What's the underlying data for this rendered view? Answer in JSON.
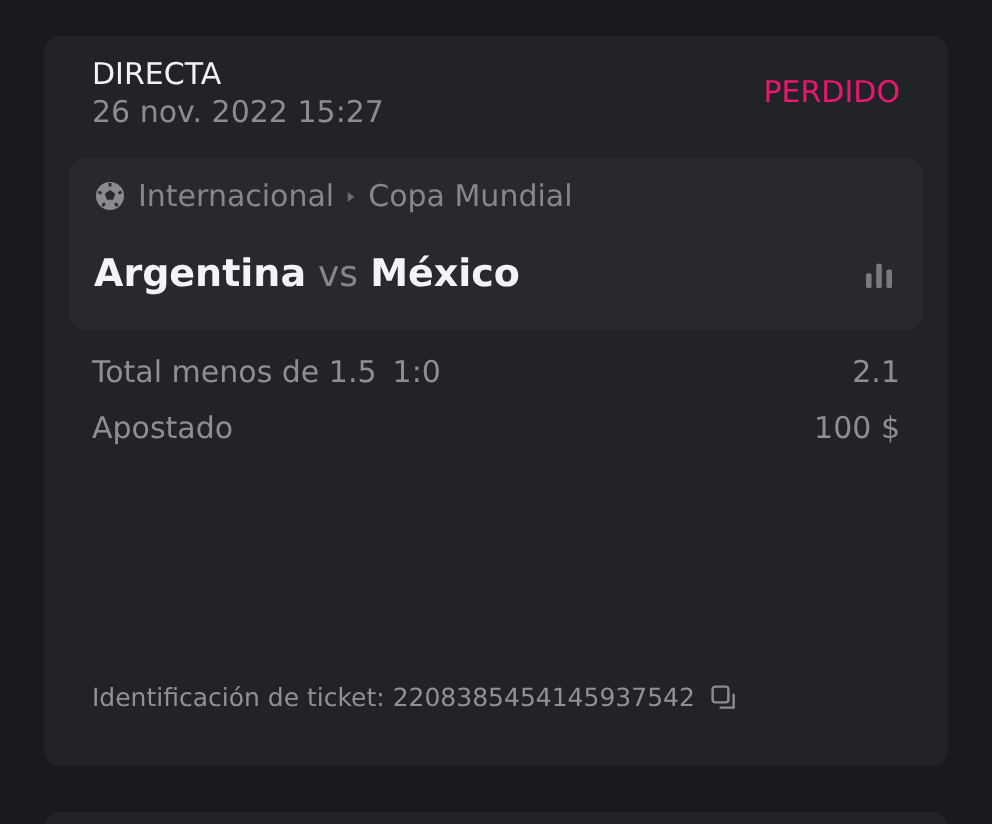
{
  "bet": {
    "type": "DIRECTA",
    "date": "26 nov. 2022 15:27",
    "lost": true,
    "result_label": "PERDIDO"
  },
  "event": {
    "category": "Internacional",
    "league": "Copa Mundial",
    "home": "Argentina",
    "vs": "vs",
    "away": "México"
  },
  "selection": {
    "market": "Total menos de 1.5",
    "score": "1:0",
    "odds": "2.1"
  },
  "stake": {
    "label": "Apostado",
    "value": "100 $"
  },
  "ticket": {
    "text": "Identificación de ticket: 2208385454145937542"
  }
}
